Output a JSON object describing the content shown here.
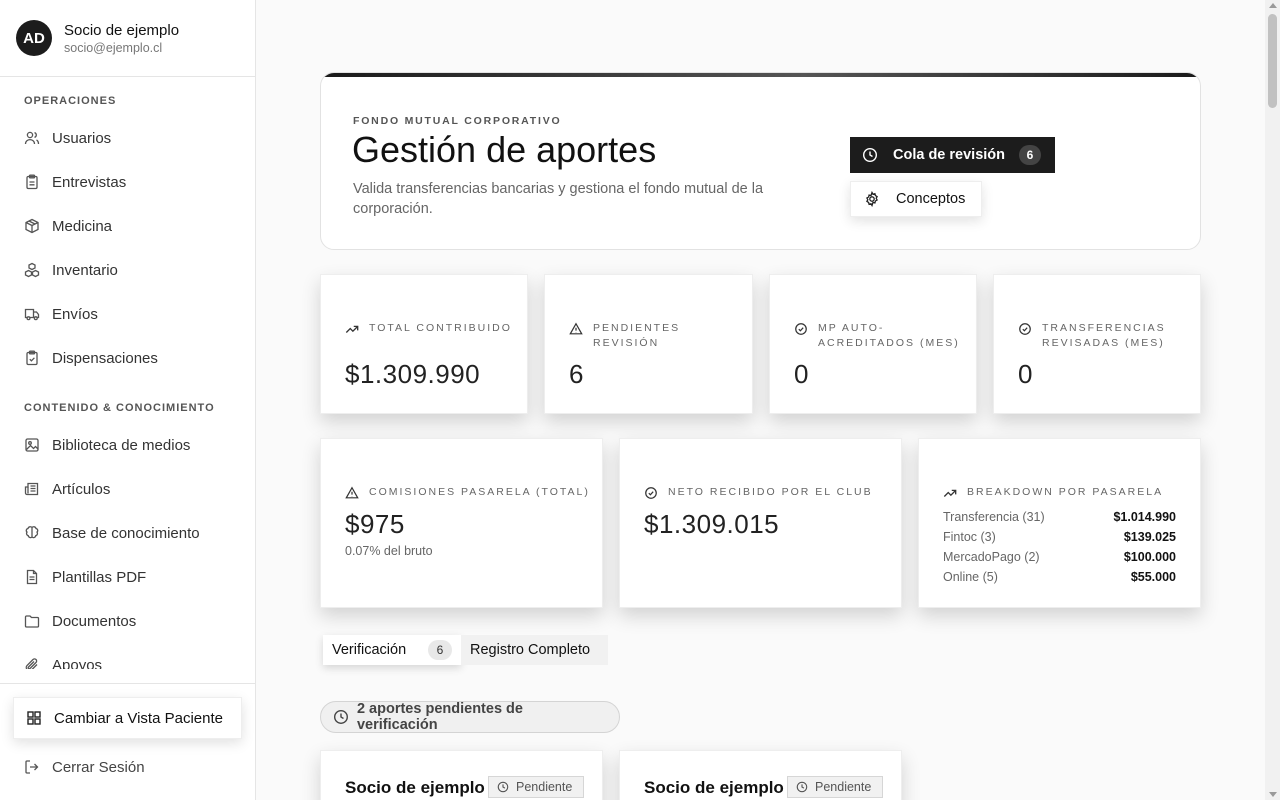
{
  "user": {
    "initials": "AD",
    "name": "Socio de ejemplo",
    "email": "socio@ejemplo.cl"
  },
  "sidebar": {
    "sections": [
      {
        "title": "OPERACIONES",
        "items": [
          {
            "label": "Usuarios",
            "icon": "users-icon"
          },
          {
            "label": "Entrevistas",
            "icon": "clipboard-icon"
          },
          {
            "label": "Medicina",
            "icon": "package-icon"
          },
          {
            "label": "Inventario",
            "icon": "boxes-icon"
          },
          {
            "label": "Envíos",
            "icon": "truck-icon"
          },
          {
            "label": "Dispensaciones",
            "icon": "clipboard-check-icon"
          }
        ]
      },
      {
        "title": "CONTENIDO & CONOCIMIENTO",
        "items": [
          {
            "label": "Biblioteca de medios",
            "icon": "image-icon"
          },
          {
            "label": "Artículos",
            "icon": "newspaper-icon"
          },
          {
            "label": "Base de conocimiento",
            "icon": "brain-icon"
          },
          {
            "label": "Plantillas PDF",
            "icon": "file-text-icon"
          },
          {
            "label": "Documentos",
            "icon": "folder-icon"
          },
          {
            "label": "Apoyos",
            "icon": "paperclip-icon"
          }
        ]
      }
    ],
    "switch_label": "Cambiar a Vista Paciente",
    "logout_label": "Cerrar Sesión"
  },
  "header": {
    "eyebrow": "FONDO MUTUAL CORPORATIVO",
    "title": "Gestión de aportes",
    "description": "Valida transferencias bancarias y gestiona el fondo mutual de la corporación.",
    "queue_label": "Cola de revisión",
    "queue_count": "6",
    "concepts_label": "Conceptos"
  },
  "stats": {
    "total": {
      "label": "TOTAL CONTRIBUIDO",
      "value": "$1.309.990"
    },
    "pending": {
      "label": "PENDIENTES REVISIÓN",
      "value": "6"
    },
    "mp": {
      "label": "MP AUTO-ACREDITADOS (MES)",
      "value": "0"
    },
    "transfers": {
      "label": "TRANSFERENCIAS REVISADAS (MES)",
      "value": "0"
    },
    "fees": {
      "label": "COMISIONES PASARELA (TOTAL)",
      "value": "$975",
      "sub": "0.07% del bruto"
    },
    "net": {
      "label": "NETO RECIBIDO POR EL CLUB",
      "value": "$1.309.015"
    },
    "breakdown": {
      "label": "BREAKDOWN POR PASARELA",
      "rows": [
        {
          "name": "Transferencia (31)",
          "value": "$1.014.990"
        },
        {
          "name": "Fintoc (3)",
          "value": "$139.025"
        },
        {
          "name": "MercadoPago (2)",
          "value": "$100.000"
        },
        {
          "name": "Online (5)",
          "value": "$55.000"
        }
      ]
    }
  },
  "tabs": {
    "verification_label": "Verificación",
    "verification_count": "6",
    "full_log_label": "Registro Completo"
  },
  "pending": {
    "summary": "2 aportes pendientes de verificación",
    "cards": [
      {
        "name": "Socio de ejemplo",
        "status": "Pendiente"
      },
      {
        "name": "Socio de ejemplo",
        "status": "Pendiente"
      }
    ]
  }
}
